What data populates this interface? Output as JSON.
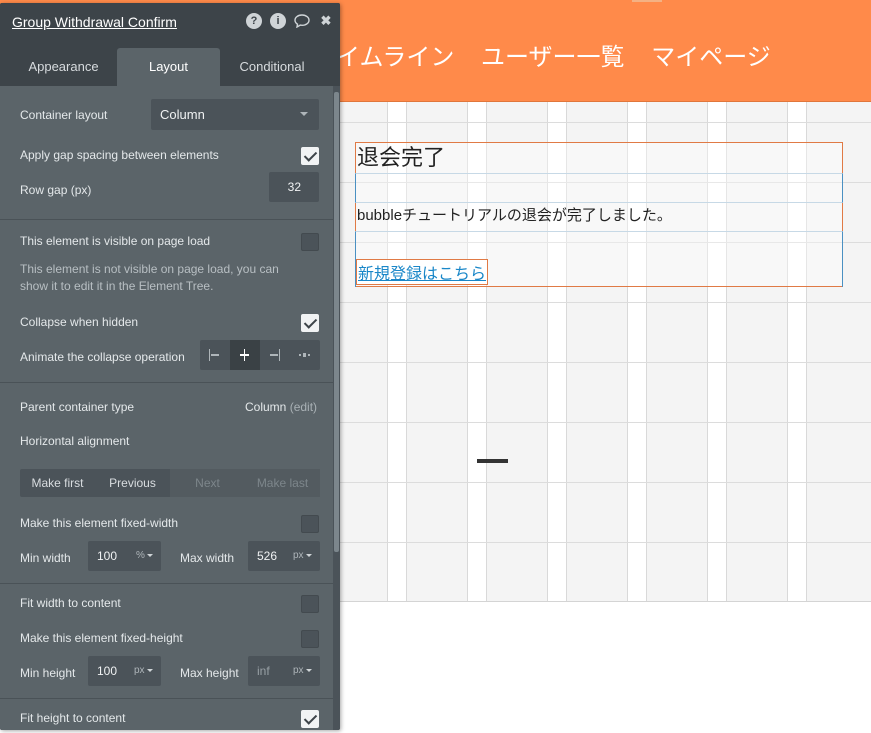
{
  "header": {
    "nav": [
      "イムライン",
      "ユーザー一覧",
      "マイページ"
    ]
  },
  "page": {
    "title": "退会完了",
    "message": "bubbleチュートリアルの退会が完了しました。",
    "register_link": "新規登録はこちら"
  },
  "panel": {
    "title": "Group Withdrawal Confirm",
    "icons": [
      "help-icon",
      "info-icon",
      "comment-icon",
      "close-icon"
    ],
    "tabs": [
      "Appearance",
      "Layout",
      "Conditional"
    ],
    "active_tab": "Layout",
    "container_layout": {
      "label": "Container layout",
      "value": "Column"
    },
    "gap_spacing": {
      "label": "Apply gap spacing between elements",
      "checked": true
    },
    "row_gap": {
      "label": "Row gap (px)",
      "value": "32"
    },
    "visible_on_load": {
      "label": "This element is visible on page load",
      "checked": false
    },
    "visible_note": "This element is not visible on page load, you can show it to edit it in the Element Tree.",
    "collapse_hidden": {
      "label": "Collapse when hidden",
      "checked": true
    },
    "animate_collapse": {
      "label": "Animate the collapse operation",
      "checked": false
    },
    "parent_type": {
      "label": "Parent container type",
      "value": "Column",
      "edit": "(edit)"
    },
    "horizontal_alignment": {
      "label": "Horizontal alignment",
      "options": [
        "align-left",
        "align-center",
        "align-right",
        "align-space"
      ],
      "active": "align-center"
    },
    "order_buttons": [
      {
        "label": "Make first",
        "enabled": true
      },
      {
        "label": "Previous",
        "enabled": true
      },
      {
        "label": "Next",
        "enabled": false
      },
      {
        "label": "Make last",
        "enabled": false
      }
    ],
    "fixed_width": {
      "label": "Make this element fixed-width",
      "checked": false
    },
    "min_width": {
      "label": "Min width",
      "value": "100",
      "unit": "%"
    },
    "max_width": {
      "label": "Max width",
      "value": "526",
      "unit": "px"
    },
    "fit_width": {
      "label": "Fit width to content",
      "checked": false
    },
    "fixed_height": {
      "label": "Make this element fixed-height",
      "checked": false
    },
    "min_height": {
      "label": "Min height",
      "value": "100",
      "unit": "px"
    },
    "max_height": {
      "label": "Max height",
      "value": "inf",
      "unit": "px"
    },
    "fit_height": {
      "label": "Fit height to content",
      "checked": true
    }
  }
}
